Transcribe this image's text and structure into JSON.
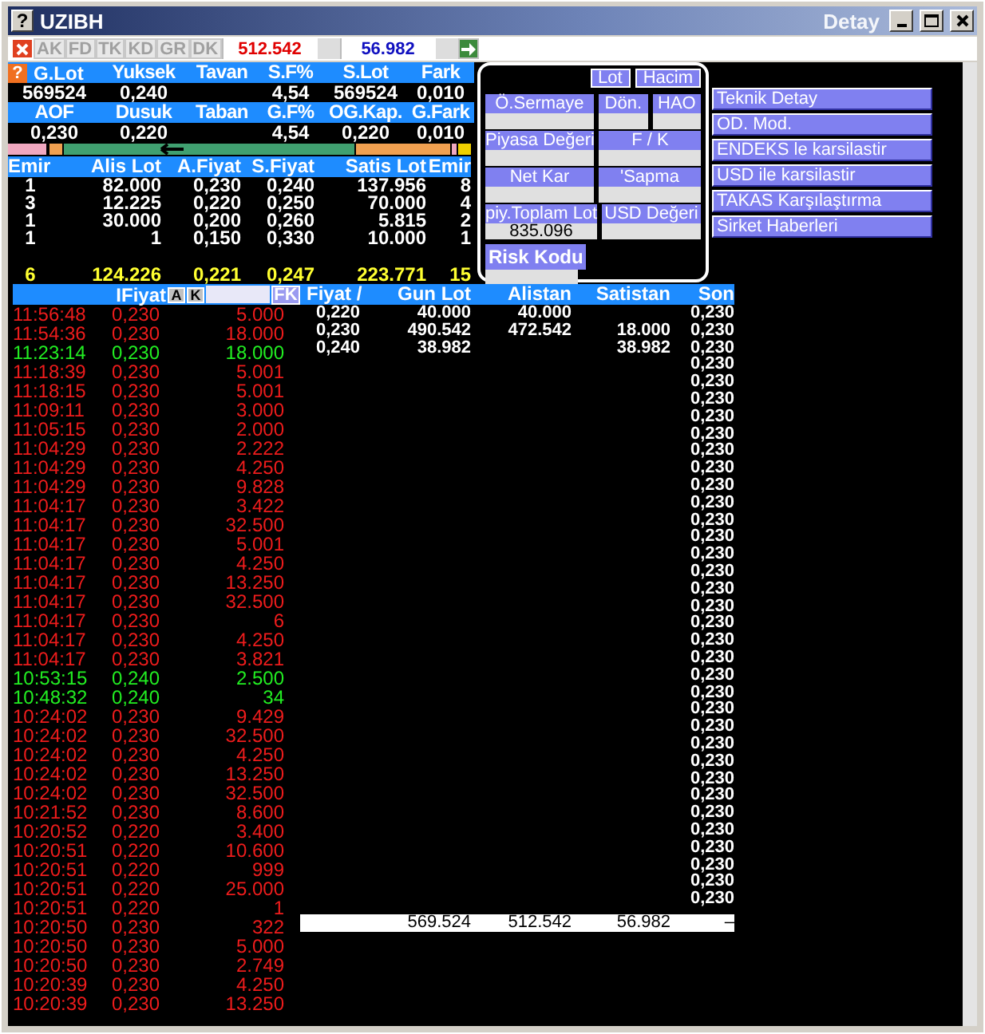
{
  "window": {
    "title": "UZIBH",
    "help_glyph": "?",
    "caption": "Detay"
  },
  "toolbar": {
    "buttons": [
      {
        "label": "AK"
      },
      {
        "label": "FD"
      },
      {
        "label": "TK"
      },
      {
        "label": "KD"
      },
      {
        "label": "GR"
      },
      {
        "label": "DK"
      }
    ],
    "sell_total": "512.542",
    "buy_total": "56.982"
  },
  "summary": {
    "help_glyph": "?",
    "blocks": [
      {
        "cells": [
          {
            "label": "G.Lot",
            "value": "569524"
          },
          {
            "label": "Yuksek",
            "value": "0,240"
          },
          {
            "label": "Tavan"
          },
          {
            "label": "S.F%",
            "value": "4,54"
          },
          {
            "label": "S.Lot",
            "value": "569524"
          },
          {
            "label": "Fark",
            "value": "0,010"
          }
        ]
      },
      {
        "cells": [
          {
            "label": "AOF",
            "value": "0,230"
          },
          {
            "label": "Dusuk",
            "value": "0,220"
          },
          {
            "label": "Taban"
          },
          {
            "label": "G.F%",
            "value": "4,54"
          },
          {
            "label": "OG.Kap.",
            "value": "0,220"
          },
          {
            "label": "G.Fark",
            "value": "0,010"
          }
        ]
      }
    ]
  },
  "order_book": {
    "columns": [
      "Emir",
      "Alis Lot",
      "A.Fiyat",
      "S.Fiyat",
      "Satis Lot",
      "Emir"
    ],
    "rows": [
      [
        "1",
        "82.000",
        "0,230",
        "0,240",
        "137.956",
        "8"
      ],
      [
        "3",
        "12.225",
        "0,220",
        "0,250",
        "70.000",
        "4"
      ],
      [
        "1",
        "30.000",
        "0,200",
        "0,260",
        "5.815",
        "2"
      ],
      [
        "1",
        "1",
        "0,150",
        "0,330",
        "10.000",
        "1"
      ]
    ],
    "totals": [
      "6",
      "124.226",
      "0,221",
      "0,247",
      "223.771",
      "15"
    ]
  },
  "fundamentals": {
    "toggles": [
      "Lot",
      "Hacim"
    ],
    "rows": [
      [
        {
          "label": "Ö.Sermaye"
        },
        {
          "label": "Dön."
        },
        {
          "label": "HAO"
        }
      ],
      [
        {
          "label": "Piyasa Değeri"
        },
        {
          "label": "F / K"
        }
      ],
      [
        {
          "label": "Net Kar"
        },
        {
          "label": "'Sapma"
        }
      ],
      [
        {
          "label": "piy.Toplam Lot",
          "value": "835.096"
        },
        {
          "label": "USD Değeri"
        }
      ]
    ],
    "risk": {
      "label": "Risk Kodu"
    }
  },
  "links": [
    "Teknik Detay",
    "OD. Mod.",
    "ENDEKS le karsilastir",
    "USD ile karsilastir",
    "TAKAS Karşılaştırma",
    "Sirket Haberleri"
  ],
  "trades": {
    "header": "IFiyat",
    "sort_buttons": [
      "A",
      "K"
    ],
    "filter_button": "FK",
    "rows": [
      {
        "time": "11:56:48",
        "price": "0,230",
        "lot": "5.000",
        "kind": "down"
      },
      {
        "time": "11:54:36",
        "price": "0,230",
        "lot": "18.000",
        "kind": "down"
      },
      {
        "time": "11:23:14",
        "price": "0,230",
        "lot": "18.000",
        "kind": "up"
      },
      {
        "time": "11:18:39",
        "price": "0,230",
        "lot": "5.001",
        "kind": "down"
      },
      {
        "time": "11:18:15",
        "price": "0,230",
        "lot": "5.001",
        "kind": "down"
      },
      {
        "time": "11:09:11",
        "price": "0,230",
        "lot": "3.000",
        "kind": "down"
      },
      {
        "time": "11:05:15",
        "price": "0,230",
        "lot": "2.000",
        "kind": "down"
      },
      {
        "time": "11:04:29",
        "price": "0,230",
        "lot": "2.222",
        "kind": "down"
      },
      {
        "time": "11:04:29",
        "price": "0,230",
        "lot": "4.250",
        "kind": "down"
      },
      {
        "time": "11:04:29",
        "price": "0,230",
        "lot": "9.828",
        "kind": "down"
      },
      {
        "time": "11:04:17",
        "price": "0,230",
        "lot": "3.422",
        "kind": "down"
      },
      {
        "time": "11:04:17",
        "price": "0,230",
        "lot": "32.500",
        "kind": "down"
      },
      {
        "time": "11:04:17",
        "price": "0,230",
        "lot": "5.001",
        "kind": "down"
      },
      {
        "time": "11:04:17",
        "price": "0,230",
        "lot": "4.250",
        "kind": "down"
      },
      {
        "time": "11:04:17",
        "price": "0,230",
        "lot": "13.250",
        "kind": "down"
      },
      {
        "time": "11:04:17",
        "price": "0,230",
        "lot": "32.500",
        "kind": "down"
      },
      {
        "time": "11:04:17",
        "price": "0,230",
        "lot": "6",
        "kind": "down"
      },
      {
        "time": "11:04:17",
        "price": "0,230",
        "lot": "4.250",
        "kind": "down"
      },
      {
        "time": "11:04:17",
        "price": "0,230",
        "lot": "3.821",
        "kind": "down"
      },
      {
        "time": "10:53:15",
        "price": "0,240",
        "lot": "2.500",
        "kind": "up"
      },
      {
        "time": "10:48:32",
        "price": "0,240",
        "lot": "34",
        "kind": "up"
      },
      {
        "time": "10:24:02",
        "price": "0,230",
        "lot": "9.429",
        "kind": "down"
      },
      {
        "time": "10:24:02",
        "price": "0,230",
        "lot": "32.500",
        "kind": "down"
      },
      {
        "time": "10:24:02",
        "price": "0,230",
        "lot": "4.250",
        "kind": "down"
      },
      {
        "time": "10:24:02",
        "price": "0,230",
        "lot": "13.250",
        "kind": "down"
      },
      {
        "time": "10:24:02",
        "price": "0,230",
        "lot": "32.500",
        "kind": "down"
      },
      {
        "time": "10:21:52",
        "price": "0,230",
        "lot": "8.600",
        "kind": "down"
      },
      {
        "time": "10:20:52",
        "price": "0,220",
        "lot": "3.400",
        "kind": "down"
      },
      {
        "time": "10:20:51",
        "price": "0,220",
        "lot": "10.600",
        "kind": "down"
      },
      {
        "time": "10:20:51",
        "price": "0,220",
        "lot": "999",
        "kind": "down"
      },
      {
        "time": "10:20:51",
        "price": "0,220",
        "lot": "25.000",
        "kind": "down"
      },
      {
        "time": "10:20:51",
        "price": "0,220",
        "lot": "1",
        "kind": "down"
      },
      {
        "time": "10:20:50",
        "price": "0,230",
        "lot": "322",
        "kind": "down"
      },
      {
        "time": "10:20:50",
        "price": "0,230",
        "lot": "5.000",
        "kind": "down"
      },
      {
        "time": "10:20:50",
        "price": "0,230",
        "lot": "2.749",
        "kind": "down"
      },
      {
        "time": "10:20:39",
        "price": "0,230",
        "lot": "4.250",
        "kind": "down"
      },
      {
        "time": "10:20:39",
        "price": "0,230",
        "lot": "13.250",
        "kind": "down"
      }
    ]
  },
  "price_table": {
    "columns": [
      "Fiyat /",
      "Gun Lot",
      "Alistan",
      "Satistan",
      "Son"
    ],
    "rows": [
      {
        "price": "0,220",
        "day_lot": "40.000",
        "bid_lot": "40.000"
      },
      {
        "price": "0,230",
        "day_lot": "490.542",
        "bid_lot": "472.542",
        "ask_lot": "18.000"
      },
      {
        "price": "0,240",
        "day_lot": "38.982",
        "ask_lot": "38.982"
      }
    ],
    "last_prices": [
      "0,230",
      "0,230",
      "0,230",
      "0,230",
      "0,230",
      "0,230",
      "0,230",
      "0,230",
      "0,230",
      "0,230",
      "0,230",
      "0,230",
      "0,230",
      "0,230",
      "0,230",
      "0,230",
      "0,230",
      "0,230",
      "0,230",
      "0,230",
      "0,230",
      "0,230",
      "0,230",
      "0,230",
      "0,230",
      "0,230",
      "0,230",
      "0,230",
      "0,230",
      "0,230",
      "0,230",
      "0,230",
      "0,230",
      "0,230",
      "0,230"
    ],
    "totals": {
      "day_lot": "569.524",
      "bid_lot": "512.542",
      "ask_lot": "56.982",
      "last": "–"
    }
  }
}
